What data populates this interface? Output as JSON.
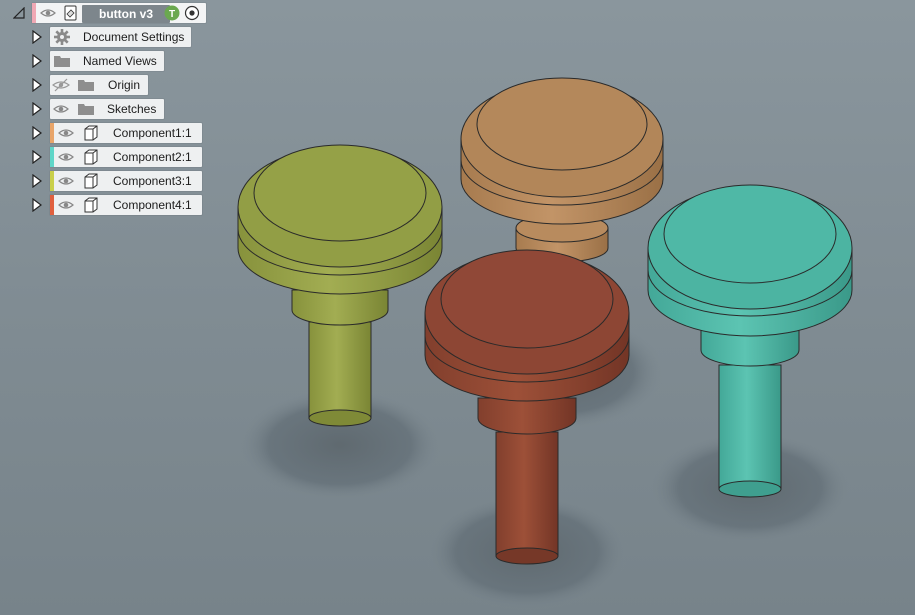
{
  "browser": {
    "root": {
      "label": "button v3",
      "badge": "T",
      "tab_color": "#f0a8b4"
    },
    "items": [
      {
        "label": "Document Settings",
        "icon": "gear-icon"
      },
      {
        "label": "Named Views",
        "icon": "folder-icon"
      },
      {
        "label": "Origin",
        "icon": "folder-icon",
        "visibility": "hidden"
      },
      {
        "label": "Sketches",
        "icon": "folder-icon",
        "visibility": "visible"
      },
      {
        "label": "Component1:1",
        "icon": "component-icon",
        "visibility": "visible",
        "tab_color": "#e8a56a"
      },
      {
        "label": "Component2:1",
        "icon": "component-icon",
        "visibility": "visible",
        "tab_color": "#5fd6c8"
      },
      {
        "label": "Component3:1",
        "icon": "component-icon",
        "visibility": "visible",
        "tab_color": "#c9cf4a"
      },
      {
        "label": "Component4:1",
        "icon": "component-icon",
        "visibility": "visible",
        "tab_color": "#e0603e"
      }
    ]
  },
  "scene": {
    "buttons": [
      {
        "name": "olive-button",
        "color": "#8f9a45"
      },
      {
        "name": "tan-button",
        "color": "#b0855a"
      },
      {
        "name": "teal-button",
        "color": "#4db3a2"
      },
      {
        "name": "rust-button",
        "color": "#8c4533"
      }
    ]
  }
}
